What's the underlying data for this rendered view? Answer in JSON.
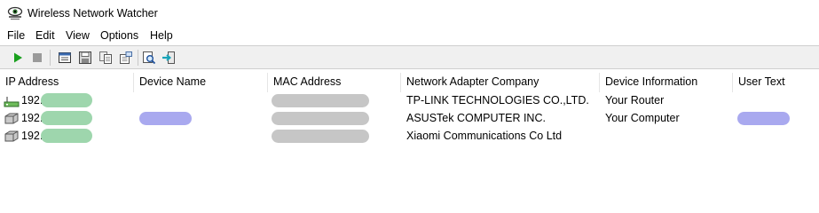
{
  "window": {
    "title": "Wireless Network Watcher",
    "icon": "eye-network-icon"
  },
  "menu": [
    "File",
    "Edit",
    "View",
    "Options",
    "Help"
  ],
  "toolbar": {
    "buttons": [
      "start-scan-icon",
      "stop-scan-icon",
      "html-report-icon",
      "save-icon",
      "copy-icon",
      "properties-icon",
      "find-icon",
      "exit-icon"
    ]
  },
  "table": {
    "columns": [
      "IP Address",
      "Device Name",
      "MAC Address",
      "Network Adapter Company",
      "Device Information",
      "User Text"
    ],
    "rows": [
      {
        "ip_prefix": "192.",
        "company": "TP-LINK TECHNOLOGIES CO.,LTD.",
        "info": "Your Router",
        "icon": "router-icon"
      },
      {
        "ip_prefix": "192.",
        "company": "ASUSTek COMPUTER INC.",
        "info": "Your Computer",
        "icon": "computer-icon"
      },
      {
        "ip_prefix": "192.",
        "company": "Xiaomi Communications Co Ltd",
        "info": "",
        "icon": "device-icon"
      }
    ]
  },
  "colors": {
    "redact_green": "#9ed6ad",
    "redact_gray": "#c6c6c6",
    "redact_purple": "#a9a9ef",
    "play_green": "#19a01e"
  }
}
